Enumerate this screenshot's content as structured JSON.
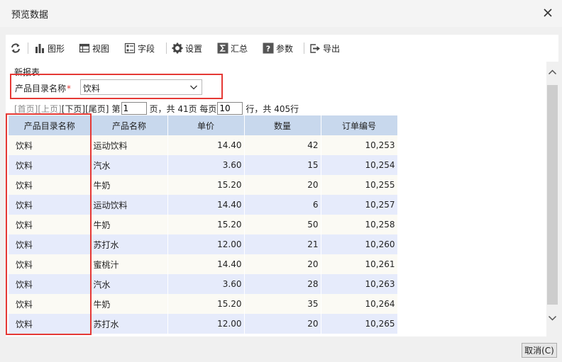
{
  "dialog": {
    "title": "预览数据",
    "cancel_label": "取消(C)"
  },
  "toolbar": {
    "refresh_icon": "refresh-icon",
    "chart_label": "图形",
    "view_label": "视图",
    "field_label": "字段",
    "settings_label": "设置",
    "summary_label": "汇总",
    "params_label": "参数",
    "export_label": "导出"
  },
  "report": {
    "name": "新报表"
  },
  "parameter": {
    "label": "产品目录名称",
    "required_mark": "*",
    "value": "饮料"
  },
  "pager": {
    "first": "[首页]",
    "prev": "[上页]",
    "next": "[下页]",
    "last": "[尾页]",
    "page_prefix": "第",
    "current_page": "1",
    "page_suffix": "页，共 41页 每页",
    "page_size": "10",
    "rows_suffix": "行，共 405行"
  },
  "table": {
    "columns": [
      "产品目录名称",
      "产品名称",
      "单价",
      "数量",
      "订单编号"
    ],
    "rows": [
      [
        "饮料",
        "运动饮料",
        "14.40",
        "42",
        "10,253"
      ],
      [
        "饮料",
        "汽水",
        "3.60",
        "15",
        "10,254"
      ],
      [
        "饮料",
        "牛奶",
        "15.20",
        "20",
        "10,255"
      ],
      [
        "饮料",
        "运动饮料",
        "14.40",
        "6",
        "10,257"
      ],
      [
        "饮料",
        "牛奶",
        "15.20",
        "50",
        "10,258"
      ],
      [
        "饮料",
        "苏打水",
        "12.00",
        "21",
        "10,260"
      ],
      [
        "饮料",
        "蜜桃汁",
        "14.40",
        "20",
        "10,261"
      ],
      [
        "饮料",
        "汽水",
        "3.60",
        "28",
        "10,263"
      ],
      [
        "饮料",
        "牛奶",
        "15.20",
        "35",
        "10,264"
      ],
      [
        "饮料",
        "苏打水",
        "12.00",
        "20",
        "10,265"
      ]
    ]
  },
  "colors": {
    "highlight_border": "#e53935",
    "header_bg": "#c8d8ed",
    "row_odd": "#fbfaf4",
    "row_even": "#e6ebfb"
  }
}
